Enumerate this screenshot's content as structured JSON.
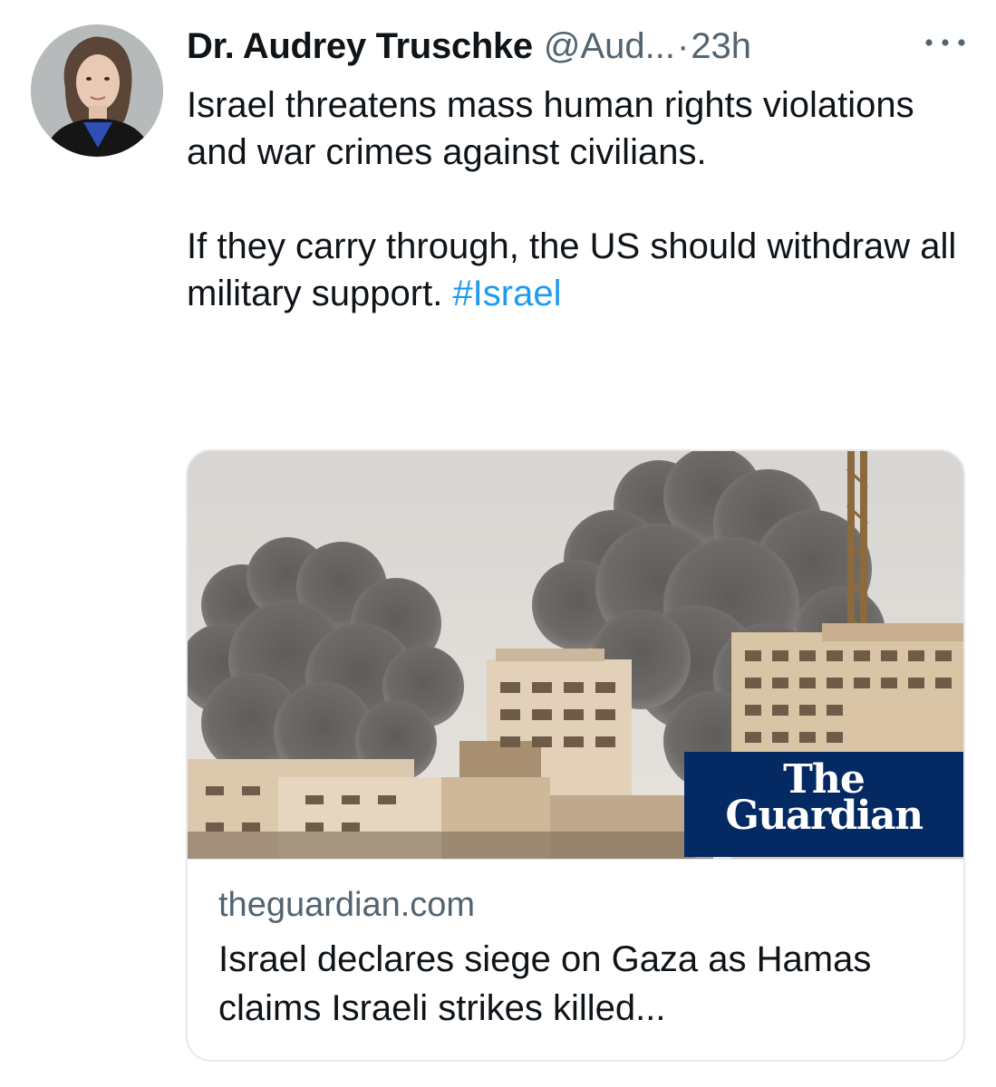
{
  "tweet": {
    "author_name": "Dr. Audrey Truschke",
    "author_handle": "@Aud...",
    "separator": "·",
    "timestamp": "23h",
    "more_icon": "ellipsis-icon",
    "text_paragraphs": [
      "Israel threatens mass human rights violations and war crimes against civilians.",
      "If they carry through, the US should withdraw all military support."
    ],
    "hashtag": "#Israel",
    "colors": {
      "text": "#0f1419",
      "secondary": "#536471",
      "link": "#1d9bf0",
      "guardian_blue": "#052962"
    }
  },
  "link_card": {
    "image_alt": "Smoke rising over buildings in Gaza",
    "logo_line1": "The",
    "logo_line2": "Guardian",
    "domain": "theguardian.com",
    "title": "Israel declares siege on Gaza as Hamas claims Israeli strikes killed..."
  }
}
